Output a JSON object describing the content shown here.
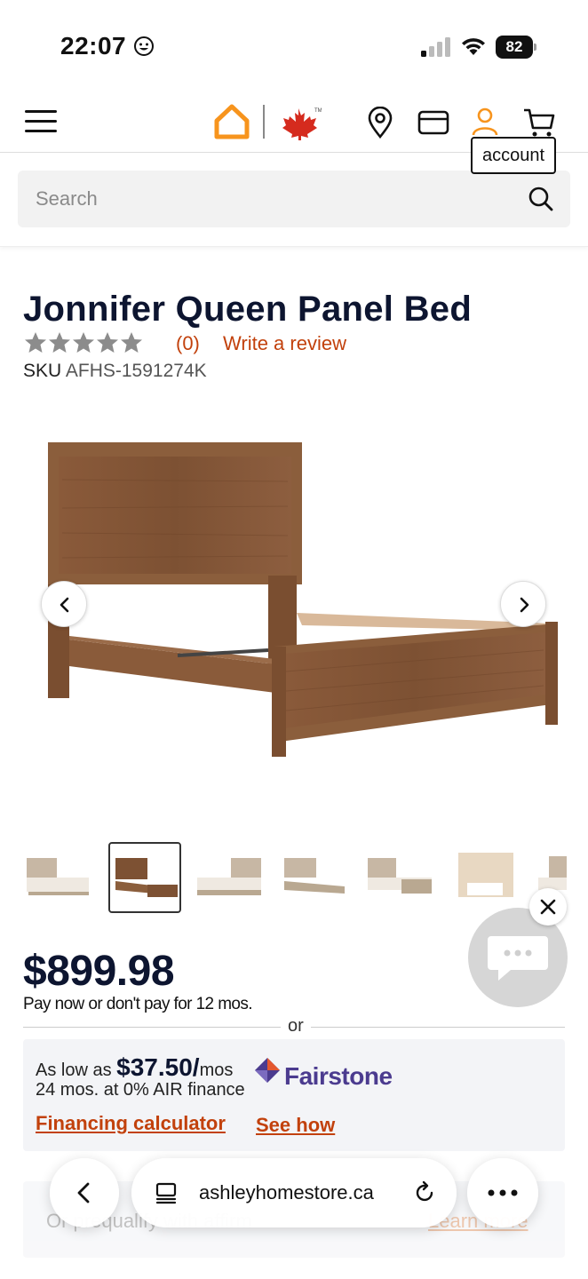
{
  "status_bar": {
    "time": "22:07",
    "battery": "82"
  },
  "header": {
    "icons": [
      "menu-icon",
      "home-logo-icon",
      "maple-leaf-icon",
      "location-icon",
      "credit-card-icon",
      "account-icon",
      "cart-icon"
    ],
    "tooltip": "account",
    "brand_color": "#f7941d",
    "maple_color": "#d52b1e"
  },
  "search": {
    "placeholder": "Search"
  },
  "product": {
    "title": "Jonnifer Queen Panel Bed",
    "rating_count": "(0)",
    "write_review": "Write a review",
    "sku_label": "SKU",
    "sku_value": "AFHS-1591274K",
    "rating_stars": 0
  },
  "gallery": {
    "thumbnail_count": 7,
    "active_index": 1
  },
  "pricing": {
    "price": "$899.98",
    "pay_now": "Pay now or don't pay for 12 mos.",
    "or": "or",
    "as_low_as": "As low as ",
    "monthly_amount": "$37.50/",
    "monthly_unit": "mos",
    "terms": "24 mos. at 0% AIR finance",
    "lender": "Fairstone",
    "financing_calculator": "Financing calculator",
    "see_how": "See how",
    "accent_color": "#c2410c"
  },
  "prequal": {
    "text": "Or prequalify with affirm",
    "learn_more": "Learn more"
  },
  "browser": {
    "url": "ashleyhomestore.ca"
  }
}
